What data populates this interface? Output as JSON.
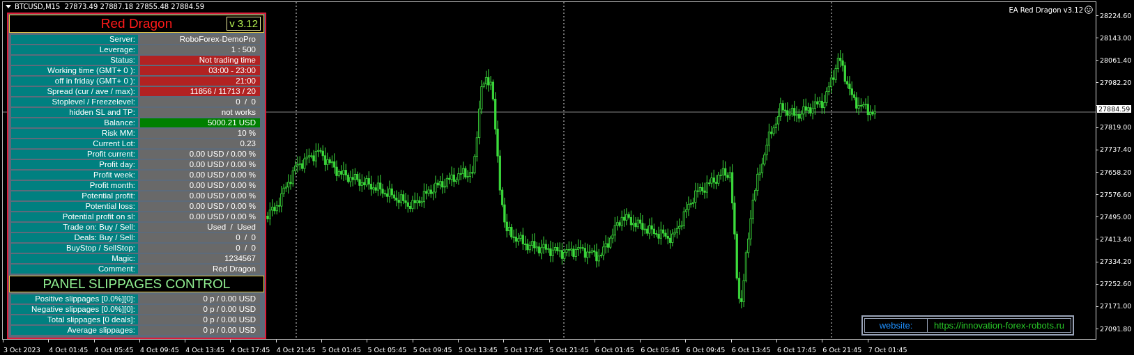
{
  "chart_header": {
    "text": "BTCUSD,M15  27873.49 27887.18 27855.48 27884.59"
  },
  "ea_label": {
    "text": "EA Red Dragon v3.12"
  },
  "panel": {
    "title": "Red Dragon",
    "version": "v 3.12",
    "rows": [
      {
        "label": "Server:",
        "value": "RoboForex-DemoPro",
        "color": "#696969"
      },
      {
        "label": "Leverage:",
        "value": "1 : 500",
        "color": "#696969"
      },
      {
        "label": "Status:",
        "value": "Not trading time",
        "color": "#b22222"
      },
      {
        "label": "Working time (GMT+ 0 ):",
        "value": "03:00 - 23:00",
        "color": "#b22222"
      },
      {
        "label": "off in friday (GMT+ 0 ):",
        "value": "21:00",
        "color": "#b22222"
      },
      {
        "label": "Spread (cur / ave / max):",
        "value": "11856 / 11713 / 20",
        "color": "#b22222"
      },
      {
        "label": "Stoplevel  /  Freezelevel:",
        "value": "0  /  0",
        "color": "#696969"
      },
      {
        "label": "hidden SL and TP:",
        "value": "not works",
        "color": "#696969"
      },
      {
        "label": "Balance:",
        "value": "5000.21 USD",
        "color": "#008000"
      },
      {
        "label": "Risk MM:",
        "value": "10 %",
        "color": "#696969"
      },
      {
        "label": "Current Lot:",
        "value": "0.23",
        "color": "#696969"
      },
      {
        "label": "Profit current:",
        "value": "0.00 USD / 0.00 %",
        "color": "#696969"
      },
      {
        "label": "Profit day:",
        "value": "0.00 USD / 0.00 %",
        "color": "#696969"
      },
      {
        "label": "Profit week:",
        "value": "0.00 USD / 0.00 %",
        "color": "#696969"
      },
      {
        "label": "Profit month:",
        "value": "0.00 USD / 0.00 %",
        "color": "#696969"
      },
      {
        "label": "Potential profit:",
        "value": "0.00 USD / 0.00 %",
        "color": "#696969"
      },
      {
        "label": "Potential loss:",
        "value": "0.00 USD / 0.00 %",
        "color": "#696969"
      },
      {
        "label": "Potential profit on sl:",
        "value": "0.00 USD / 0.00 %",
        "color": "#696969"
      },
      {
        "label": "Trade on: Buy  /  Sell:",
        "value": "Used  /  Used",
        "color": "#696969"
      },
      {
        "label": "Deals: Buy / Sell:",
        "value": "0  /  0",
        "color": "#696969"
      },
      {
        "label": "BuyStop / SellStop:",
        "value": "0  /  0",
        "color": "#696969"
      },
      {
        "label": "Magic:",
        "value": "1234567",
        "color": "#696969"
      },
      {
        "label": "Comment:",
        "value": "Red Dragon",
        "color": "#696969"
      }
    ],
    "section": {
      "title": "PANEL SLIPPAGES CONTROL",
      "rows": [
        {
          "label": "Positive slippages [0.0%][0]:",
          "value": "0 p / 0.00 USD",
          "color": "#696969"
        },
        {
          "label": "Negative slippages [0.0%][0]:",
          "value": "0 p / 0.00 USD",
          "color": "#696969"
        },
        {
          "label": "Total slippages [0 deals]:",
          "value": "0 p / 0.00 USD",
          "color": "#696969"
        },
        {
          "label": "Average slippages:",
          "value": "0 p / 0.00 USD",
          "color": "#696969"
        }
      ]
    }
  },
  "website": {
    "label": "website:",
    "url": "https://innovation-forex-robots.ru"
  },
  "price_axis": {
    "items": [
      {
        "kind": "tick",
        "text": "28224.60"
      },
      {
        "kind": "tick",
        "text": "28143.00"
      },
      {
        "kind": "tick",
        "text": "28061.40"
      },
      {
        "kind": "tick",
        "text": "27982.20"
      },
      {
        "kind": "current",
        "text": "27884.59"
      },
      {
        "kind": "tick",
        "text": "27819.00"
      },
      {
        "kind": "tick",
        "text": "27737.40"
      },
      {
        "kind": "tick",
        "text": "27658.20"
      },
      {
        "kind": "tick",
        "text": "27576.60"
      },
      {
        "kind": "tick",
        "text": "27495.00"
      },
      {
        "kind": "tick",
        "text": "27413.40"
      },
      {
        "kind": "tick",
        "text": "27334.20"
      },
      {
        "kind": "tick",
        "text": "27252.60"
      },
      {
        "kind": "tick",
        "text": "27171.00"
      },
      {
        "kind": "tick",
        "text": "27091.80"
      }
    ]
  },
  "time_axis": {
    "labels": [
      "3 Oct 2023",
      "4 Oct 01:45",
      "4 Oct 05:45",
      "4 Oct 09:45",
      "4 Oct 13:45",
      "4 Oct 17:45",
      "4 Oct 21:45",
      "5 Oct 01:45",
      "5 Oct 05:45",
      "5 Oct 09:45",
      "5 Oct 13:45",
      "5 Oct 17:45",
      "5 Oct 21:45",
      "6 Oct 01:45",
      "6 Oct 05:45",
      "6 Oct 09:45",
      "6 Oct 13:45",
      "6 Oct 17:45",
      "6 Oct 21:45",
      "7 Oct 01:45"
    ]
  }
}
